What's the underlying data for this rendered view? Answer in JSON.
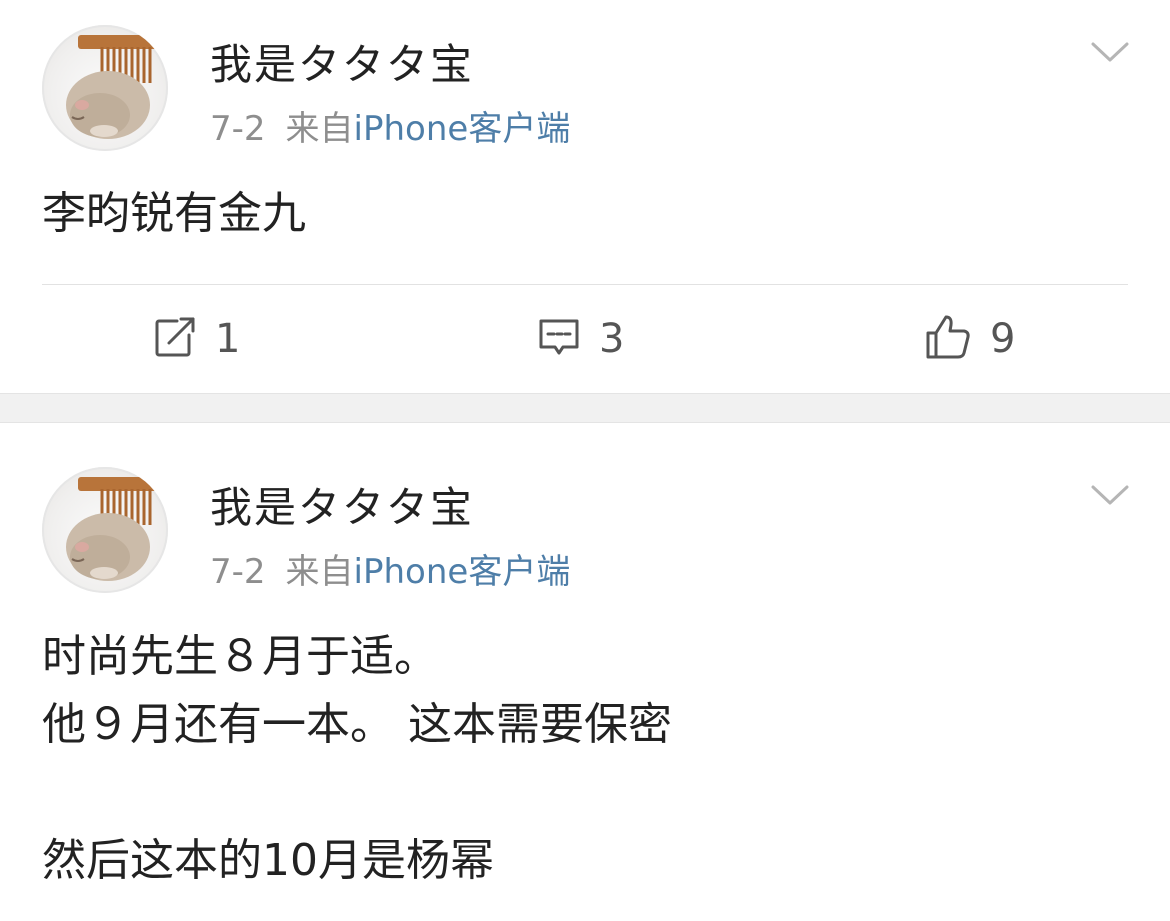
{
  "posts": [
    {
      "username": "我是タタタ宝",
      "date": "7-2",
      "source_prefix": "来自",
      "source_client": "iPhone客户端",
      "content": "李昀锐有金九",
      "actions": {
        "repost_count": "1",
        "comment_count": "3",
        "like_count": "9"
      }
    },
    {
      "username": "我是タタタ宝",
      "date": "7-2",
      "source_prefix": "来自",
      "source_client": "iPhone客户端",
      "content": "时尚先生８月于适。\n他９月还有一本。 这本需要保密\n\n然后这本的10月是杨幂"
    }
  ],
  "icons": {
    "avatar": "hamster-with-comb-avatar",
    "menu": "chevron-down-icon",
    "repost": "repost-icon",
    "comment": "comment-icon",
    "like": "thumbs-up-icon"
  },
  "colors": {
    "link_blue": "#4e7ea8",
    "meta_gray": "#8e8e8e",
    "text_dark": "#222222",
    "separator_gray": "#f1f1f1"
  }
}
